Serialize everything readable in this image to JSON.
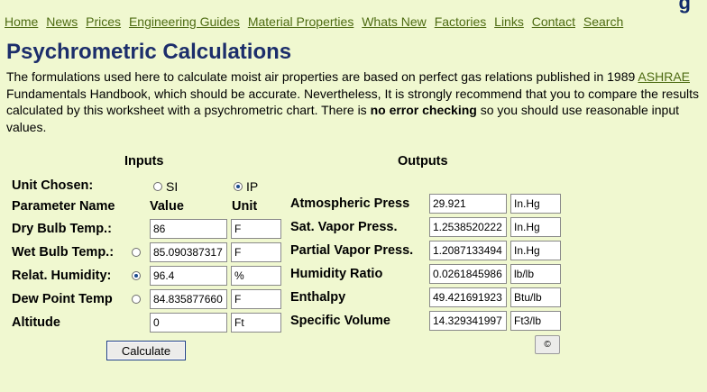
{
  "nav": [
    "Home",
    "News",
    "Prices",
    "Engineering Guides",
    "Material Properties",
    "Whats New",
    "Factories",
    "Links",
    "Contact",
    "Search"
  ],
  "corner_mark": "g",
  "title": "Psychrometric Calculations",
  "intro": {
    "before": "The formulations used here to calculate moist air properties are based on perfect gas relations published in 1989 ",
    "link": "ASHRAE",
    "middle": " Fundamentals Handbook, which should be accurate. Nevertheless, It is strongly recommend that you to compare the results calculated by this worksheet with a psychrometric chart. There is ",
    "bold": "no error checking",
    "after": " so you should use reasonable input values."
  },
  "inputs": {
    "heading": "Inputs",
    "unit_chosen_label": "Unit Chosen:",
    "unit_si": "SI",
    "unit_ip": "IP",
    "selected_unit": "IP",
    "col_param": "Parameter Name",
    "col_value": "Value",
    "col_unit": "Unit",
    "dry_bulb": {
      "label": "Dry Bulb Temp.:",
      "value": "86",
      "unit": "F"
    },
    "wet_bulb": {
      "label": "Wet Bulb Temp.:",
      "value": "85.090387317",
      "unit": "F",
      "selected": false
    },
    "humidity": {
      "label": "Relat. Humidity:",
      "value": "96.4",
      "unit": "%",
      "selected": true
    },
    "dew_point": {
      "label": "Dew Point Temp",
      "value": "84.835877660",
      "unit": "F",
      "selected": false
    },
    "altitude": {
      "label": "Altitude",
      "value": "0",
      "unit": "Ft"
    },
    "calculate_label": "Calculate"
  },
  "outputs": {
    "heading": "Outputs",
    "atm_press": {
      "label": "Atmospheric Press",
      "value": "29.921",
      "unit": "In.Hg"
    },
    "sat_vapor": {
      "label": "Sat. Vapor Press.",
      "value": "1.2538520222",
      "unit": "In.Hg"
    },
    "partial_vapor": {
      "label": "Partial Vapor Press.",
      "value": "1.2087133494",
      "unit": "In.Hg"
    },
    "humidity_ratio": {
      "label": "Humidity Ratio",
      "value": "0.0261845986",
      "unit": "lb/lb"
    },
    "enthalpy": {
      "label": "Enthalpy",
      "value": "49.421691923",
      "unit": "Btu/lb"
    },
    "specific_volume": {
      "label": "Specific Volume",
      "value": "14.329341997",
      "unit": "Ft3/lb"
    },
    "copyright_label": "©"
  }
}
